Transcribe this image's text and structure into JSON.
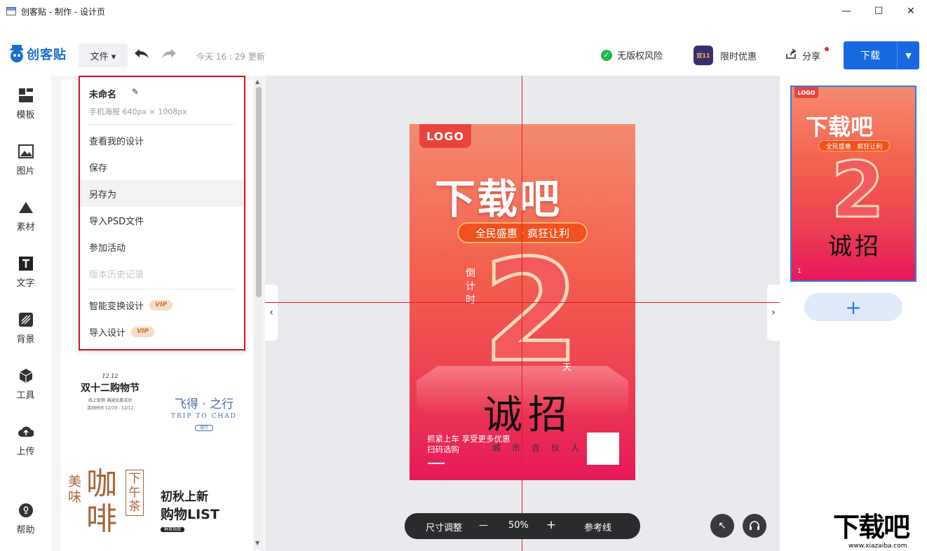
{
  "window": {
    "title": "创客贴 - 制作 - 设计页",
    "controls": [
      "—",
      "☐",
      "✕"
    ]
  },
  "toolbar": {
    "logo_text": "创客贴",
    "file_label": "文件 ▾",
    "save_status": "今天 16 : 29 更新",
    "copyright_label": "无版权风险",
    "promo_label": "限时优惠",
    "promo_badge": "双11",
    "share_label": "分享",
    "download_label": "下载"
  },
  "leftnav": {
    "items": [
      {
        "label": "模板",
        "icon": "template-icon"
      },
      {
        "label": "图片",
        "icon": "image-icon"
      },
      {
        "label": "素材",
        "icon": "material-icon"
      },
      {
        "label": "文字",
        "icon": "text-icon"
      },
      {
        "label": "背景",
        "icon": "background-icon"
      },
      {
        "label": "工具",
        "icon": "tools-icon"
      },
      {
        "label": "上传",
        "icon": "upload-icon"
      },
      {
        "label": "帮助",
        "icon": "help-icon"
      }
    ]
  },
  "file_menu": {
    "doc_name": "未命名",
    "doc_size": "手机海报  640px × 1008px",
    "items": [
      {
        "label": "查看我的设计"
      },
      {
        "label": "保存"
      },
      {
        "label": "另存为"
      },
      {
        "label": "导入PSD文件"
      },
      {
        "label": "参加活动"
      },
      {
        "label": "版本历史记录"
      },
      {
        "label": "智能变换设计",
        "badge": "VIP"
      },
      {
        "label": "导入设计",
        "badge": "VIP"
      }
    ]
  },
  "text_templates": {
    "t1_date": "12.12",
    "t1_title": "双十二购物节",
    "t1_sub": "线上促销  满减优惠活动",
    "t1_range": "活动时间 12/10 - 12/12",
    "t2_title": "飞得 · 之行",
    "t2_en": "TRIP TO CHAD",
    "t2_tag": "旅行",
    "t3_left": "美味",
    "t3_main": "咖啡",
    "t3_side": "下午茶",
    "t4_line1": "初秋上新",
    "t4_line2": "购物LIST",
    "t4_tag": "种草指南"
  },
  "poster": {
    "logo": "LOGO",
    "headline": "下载吧",
    "pill": "全民盛惠 · 疯狂让利",
    "countdown": "倒计时",
    "big_number": "2",
    "day": "天",
    "recruit": "诚招",
    "bottom_line1": "抓紧上车 享受更多优惠",
    "bottom_line2": "扫码选购",
    "partner": "城市合伙人"
  },
  "zoombar": {
    "resize": "尺寸调整",
    "minus": "—",
    "zoom": "50%",
    "plus": "+",
    "guides": "参考线"
  },
  "page_panel": {
    "page_number": "1",
    "add_label": "+"
  },
  "watermark": {
    "brand": "下载吧",
    "url": "www.xiazaiba.com"
  },
  "colors": {
    "accent": "#1769e0",
    "menu_border": "#d1141b",
    "guide": "#e61e1e"
  }
}
